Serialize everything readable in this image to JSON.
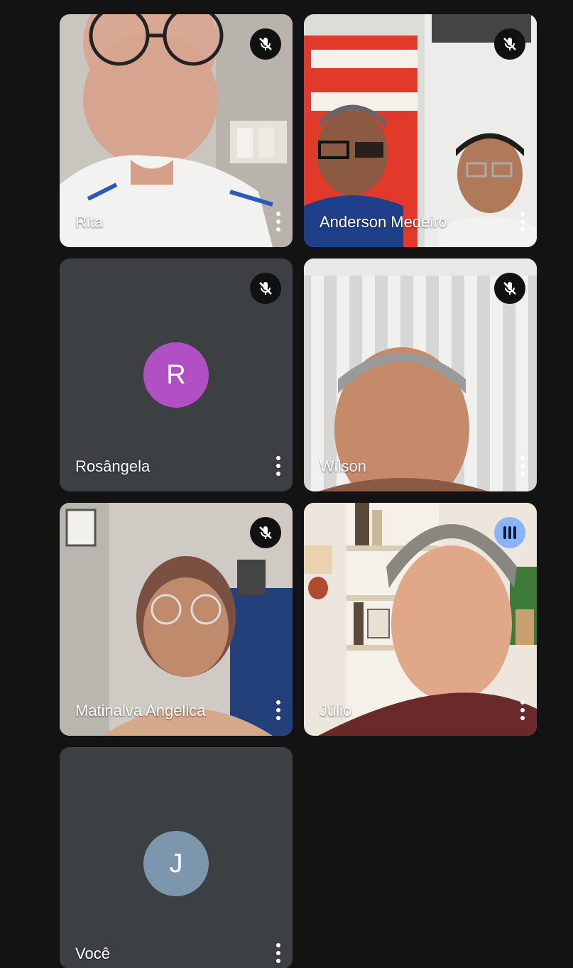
{
  "participants": [
    {
      "name": "Rita",
      "muted": true
    },
    {
      "name": "Anderson Medeiro",
      "muted": true
    },
    {
      "name": "Rosângela",
      "muted": true,
      "avatar_initial": "R",
      "avatar_color": "#b150c4"
    },
    {
      "name": "Wilson",
      "muted": true
    },
    {
      "name": "Matinalva Angelica",
      "muted": true
    },
    {
      "name": "Júlio",
      "muted": false,
      "speaking": true
    },
    {
      "name": "Você",
      "avatar_initial": "J",
      "avatar_color": "#7c96ad"
    }
  ],
  "icons": {
    "mute": "mic-off-icon",
    "speaking": "audio-level-icon",
    "more": "more-vert-icon"
  },
  "colors": {
    "background": "#131313",
    "tile": "#3c4043",
    "speaking_badge": "#8ab4f8"
  }
}
